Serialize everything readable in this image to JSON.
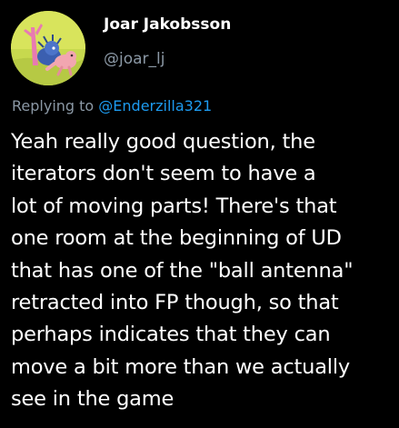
{
  "author": {
    "name": "Joar Jakobsson",
    "handle": "@joar_lj",
    "avatar_icon": "slugcat-avatar-icon"
  },
  "reply": {
    "prefix": "Replying to",
    "mention": "@Enderzilla321"
  },
  "tweet": {
    "lines": [
      "Yeah really good question, the",
      "iterators don't seem to have a",
      "lot of moving parts! There's that",
      "one room at the beginning of UD",
      "that has one of the \"ball antenna\"",
      "retracted into FP though, so that",
      "perhaps indicates that they can",
      "move a bit more than we actually",
      "see in the game"
    ]
  },
  "colors": {
    "background": "#000000",
    "primary_text": "#ffffff",
    "secondary_text": "#8b98a5",
    "link": "#1d9bf0"
  }
}
